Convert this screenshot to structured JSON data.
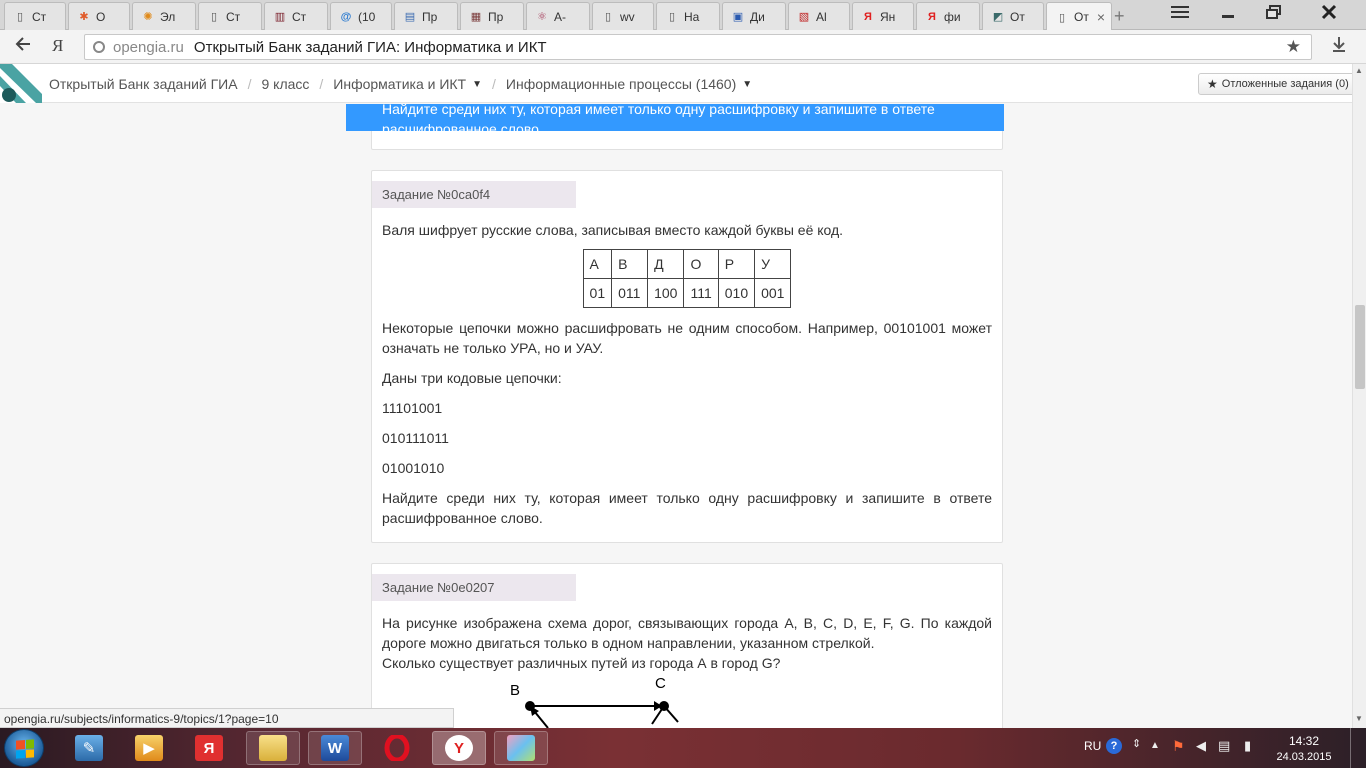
{
  "browser": {
    "tabs": [
      {
        "label": "Ст",
        "icon": "page-icon",
        "color": "#555555"
      },
      {
        "label": "О",
        "icon": "joomla-icon",
        "color": "#e05b2a"
      },
      {
        "label": "Эл",
        "icon": "sun-icon",
        "color": "#e08a1a"
      },
      {
        "label": "Ст",
        "icon": "page-icon",
        "color": "#555555"
      },
      {
        "label": "Ст",
        "icon": "book-icon",
        "color": "#7a1e2a"
      },
      {
        "label": "(10",
        "icon": "at-icon",
        "color": "#2a7ad0"
      },
      {
        "label": "Пр",
        "icon": "doc-icon",
        "color": "#3a6ab0"
      },
      {
        "label": "Пр",
        "icon": "slides-icon",
        "color": "#7a3a3a"
      },
      {
        "label": "А-",
        "icon": "atom-icon",
        "color": "#a03050"
      },
      {
        "label": "wv",
        "icon": "page-icon",
        "color": "#555555"
      },
      {
        "label": "На",
        "icon": "page-icon",
        "color": "#555555"
      },
      {
        "label": "Ди",
        "icon": "chat-icon",
        "color": "#2a5ab0"
      },
      {
        "label": "Al",
        "icon": "cart-icon",
        "color": "#c02020"
      },
      {
        "label": "Ян",
        "icon": "yandex-icon",
        "color": "#e02020"
      },
      {
        "label": "фи",
        "icon": "yandex-icon",
        "color": "#e02020"
      },
      {
        "label": "От",
        "icon": "logo-icon",
        "color": "#3a6a6a"
      },
      {
        "label": "От",
        "icon": "page-icon",
        "color": "#555555"
      }
    ],
    "url_host": "opengia.ru",
    "page_title": "Открытый Банк заданий ГИА: Информатика и ИКТ",
    "status_url": "opengia.ru/subjects/informatics-9/topics/1?page=10"
  },
  "nav": {
    "breadcrumbs": [
      "Открытый Банк заданий ГИА",
      "9 класс",
      "Информатика и ИКТ",
      "Информационные процессы (1460)"
    ],
    "postponed_label": "Отложенные задания (0)"
  },
  "tasks": [
    {
      "partial_line1": "Найдите среди них ту, которая имеет только одну расшифровку и запишите в ответе",
      "partial_line2": "расшифрованное слово."
    },
    {
      "header": "Задание №0ca0f4",
      "intro": "Валя шифрует русские слова, записывая вместо каждой буквы её код.",
      "table": {
        "letters": [
          "А",
          "В",
          "Д",
          "О",
          "Р",
          "У"
        ],
        "codes": [
          "01",
          "011",
          "100",
          "111",
          "010",
          "001"
        ]
      },
      "para1": "Некоторые цепочки можно расшифровать не одним способом. Например, 00101001 может означать не только УРА, но и УАУ.",
      "para2": "Даны три кодовые цепочки:",
      "chains": [
        "11101001",
        "010111011",
        "01001010"
      ],
      "para3": "Найдите среди них ту, которая имеет только одну расшифровку и запишите в ответе расшифрованное слово."
    },
    {
      "header": "Задание №0e0207",
      "para1": "На рисунке изображена схема дорог, связывающих города А, B, C, D, E, F, G. По каждой дороге можно двигаться только в одном направлении, указанном стрелкой.",
      "para2": "Сколько существует различных путей из города А в город G?",
      "graph_labels": [
        "B",
        "C"
      ]
    }
  ],
  "taskbar": {
    "items": [
      "explorer-icon",
      "media-icon",
      "yandex-icon",
      "files-icon",
      "word-icon",
      "opera-icon",
      "yandex-browser-icon",
      "paint-icon"
    ],
    "lang": "RU",
    "time": "14:32",
    "date": "24.03.2015"
  }
}
